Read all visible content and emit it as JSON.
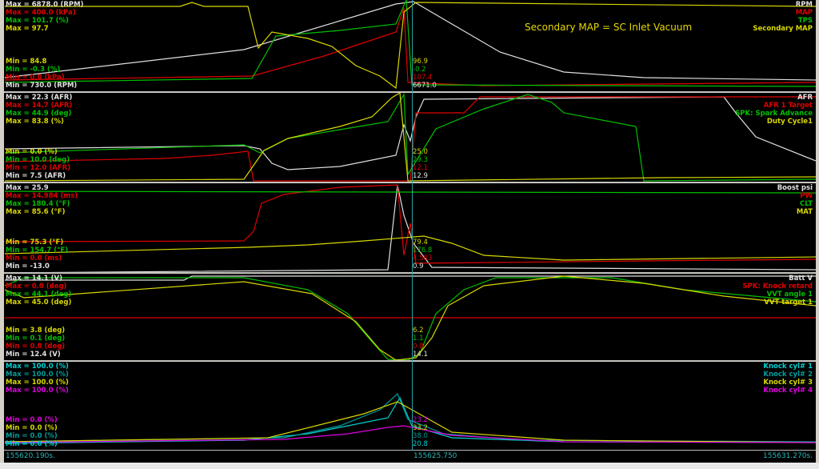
{
  "annotation": "Secondary MAP = SC Inlet Vacuum",
  "colors": {
    "white": "#e0e0e0",
    "red": "#e00000",
    "green": "#00c000",
    "yellow": "#d8d800",
    "cyan": "#00d0d0",
    "teal": "#009c9c",
    "magenta": "#e000e0"
  },
  "panels": [
    {
      "names": [
        "RPM",
        "MAP",
        "TPS",
        "Secondary MAP"
      ],
      "max": [
        "Max = 6878.0 (RPM)",
        "Max = 400.0 (kPa)",
        "Max = 101.7 (%)",
        "Max = 97.7"
      ],
      "min": [
        "Min = 84.8",
        "Min = -0.3 (%)",
        "Min = 0.0 (kPa)",
        "Min = 730.0 (RPM)"
      ],
      "cursor": [
        "96.9",
        "-0.2",
        "107.4",
        "6671.0"
      ]
    },
    {
      "names": [
        "AFR",
        "AFR 1 Target",
        "SPK: Spark Advance",
        "Duty Cycle1"
      ],
      "max": [
        "Max = 22.3 (AFR)",
        "Max = 14.7 (AFR)",
        "Max = 44.9 (deg)",
        "Max = 83.8 (%)"
      ],
      "min": [
        "Min = 0.0 (%)",
        "Min = 10.0 (deg)",
        "Min = 12.0 (AFR)",
        "Min = 7.5 (AFR)"
      ],
      "cursor": [
        "25.0",
        "29.3",
        "12.1",
        "12.9"
      ]
    },
    {
      "names": [
        "Boost psi",
        "PW",
        "CLT",
        "MAT"
      ],
      "max": [
        "Max = 25.9",
        "Max = 14.984 (ms)",
        "Max = 180.4 (°F)",
        "Max = 85.6 (°F)"
      ],
      "min": [
        "Min = 75.3 (°F)",
        "Min = 154.7 (°F)",
        "Min = 0.0 (ms)",
        "Min = -13.0"
      ],
      "cursor": [
        "79.4",
        "176.8",
        "4.503",
        "0.9"
      ]
    },
    {
      "names": [
        "Batt V",
        "SPK: Knock retard",
        "VVT angle 1",
        "VVT target 1"
      ],
      "max": [
        "Max = 14.1 (V)",
        "Max = 0.0 (deg)",
        "Max = 44.1 (deg)",
        "Max = 45.0 (deg)"
      ],
      "min": [
        "Min = 3.8 (deg)",
        "Min = 0.1 (deg)",
        "Min = 0.0 (deg)",
        "Min = 12.4 (V)"
      ],
      "cursor": [
        "6.2",
        "1.1",
        "0.0",
        "14.1"
      ]
    },
    {
      "names": [
        "Knock cyl# 1",
        "Knock cyl# 2",
        "Knock cyl# 3",
        "Knock cyl# 4"
      ],
      "max": [
        "Max = 100.0 (%)",
        "Max = 100.0 (%)",
        "Max = 100.0 (%)",
        "Max = 100.0 (%)"
      ],
      "min": [
        "Min = 0.0 (%)",
        "Min = 0.0 (%)",
        "Min = 0.0 (%)",
        "Min = 0.0 (%)"
      ],
      "cursor": [
        "23.2",
        "33.2",
        "38.0",
        "20.8"
      ]
    }
  ],
  "time": {
    "start": "155620.190s.",
    "cursor": "155625.750",
    "end": "155631.270s."
  }
}
